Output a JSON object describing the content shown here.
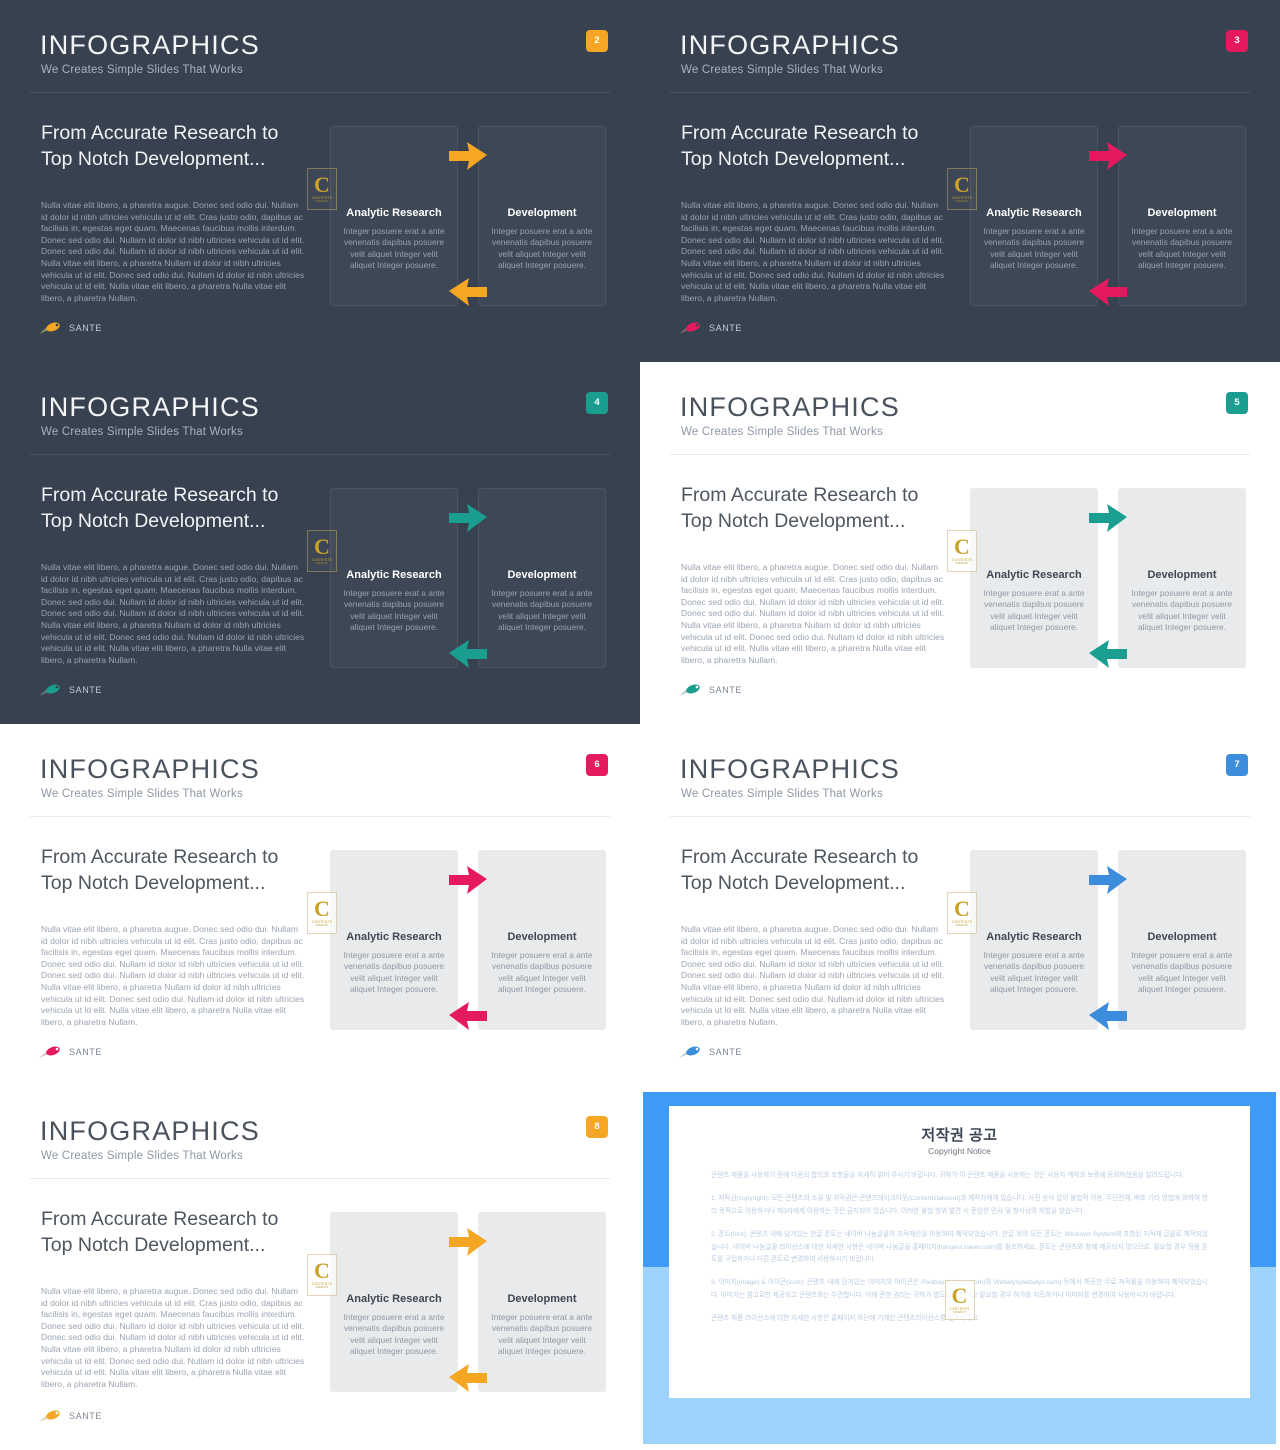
{
  "deck": {
    "header_title": "INFOGRAPHICS",
    "header_subtitle": "We Creates Simple Slides That Works",
    "lead": "From Accurate Research to Top Notch Development...",
    "paragraph": "Nulla vitae elit libero, a pharetra augue. Donec sed odio dui. Nullam id dolor id nibh ultricies vehicula ut id elit. Cras justo odio, dapibus ac facilisis in, egestas eget quam. Maecenas faucibus mollis interdum. Donec sed odio dui. Nullam id dolor id nibh ultricies vehicula ut id elit. Donec sed odio dui. Nullam id dolor id nibh ultricies vehicula ut id elit. Nulla vitae elit libero, a pharetra Nullam id dolor id nibh ultricies vehicula ut id elit. Donec sed odio dui. Nullam id dolor id nibh ultricies vehicula ut id elit. Nulla vitae elit libero, a pharetra Nulla vitae elit libero, a pharetra Nullam.",
    "card_a_title": "Analytic Research",
    "card_b_title": "Development",
    "card_body": "Integer posuere erat a ante venenatis dapibus posuere velit aliquet Integer velit aliquet Integer posuere.",
    "footer_brand": "SANTE",
    "watermark": {
      "letter": "C",
      "line1": "CONTENTS",
      "line2": "TAKEOUT"
    }
  },
  "slides": [
    {
      "number": "2",
      "theme": "dark",
      "accent": "#f5a623",
      "badge_color": "#f5a623",
      "arrow_color": "#f5a623"
    },
    {
      "number": "3",
      "theme": "dark",
      "accent": "#e51a5e",
      "badge_color": "#e51a5e",
      "arrow_color": "#e51a5e"
    },
    {
      "number": "4",
      "theme": "dark",
      "accent": "#1a9e8f",
      "badge_color": "#1a9e8f",
      "arrow_color": "#1a9e8f"
    },
    {
      "number": "5",
      "theme": "light",
      "accent": "#1a9e8f",
      "badge_color": "#1a9e8f",
      "arrow_color": "#1a9e8f"
    },
    {
      "number": "6",
      "theme": "light",
      "accent": "#e51a5e",
      "badge_color": "#e51a5e",
      "arrow_color": "#e51a5e"
    },
    {
      "number": "7",
      "theme": "light",
      "accent": "#3d8ddd",
      "badge_color": "#3d8ddd",
      "arrow_color": "#3d8ddd"
    },
    {
      "number": "8",
      "theme": "light",
      "accent": "#f5a623",
      "badge_color": "#f5a623",
      "arrow_color": "#f5a623"
    }
  ],
  "copyright": {
    "title": "저작권 공고",
    "subtitle": "Copyright Notice",
    "intro": "콘텐츠 제품을 사용하기 전에 다음의 합의과 조항들을 자세히 읽어 주시기 바랍니다. 귀하가 이 콘텐츠 제품을 사용하는 것은 사용자 계약과 보증에 동의하셨음을 알려드립니다.",
    "clause1": "1. 저작권(copyright): 모든 콘텐츠의 소유 및 저작권은 콘텐츠테이크아웃(Contentstakeout)과 제작자에게 있습니다. 사전 승낙 없이 불법적 이용, 무단전재, 배포 기타 방법에 의하여 영리 목적으로 이용하거나 제3자에게 이용하는 것은 금지되어 있습니다. 이러한 불법 행위 발견 시 준엄한 민사 및 형사상의 처벌을 받습니다.",
    "clause2": "2. 폰트(font): 콘텐츠 내에 담겨있는 한글 폰트는 네이버 나눔글꼴의 지적재산을 이용하여 제작되었습니다. 한글 외의 모든 폰트는 Windows System에 포함된 지적재 글꼴로 제작되었습니다. 네이버 나눔글꼴 라이선스에 대한 자세한 사항은 네이버 나눔글꼴 홈페이지(hangeul.naver.com)를 참조하세요. 폰트는 콘텐츠와 함께 제공되지 않으므로, 필요할 경우 정품 폰트를 구입하거나 다른 폰트로 변경하여 사용하시기 바랍니다.",
    "clause3": "3. 이미지(image) & 아이콘(icon): 콘텐츠 내에 담겨있는 이미지와 아이콘은 Pixabay(pixabay.com)와 Webalys(webalys.com) 등에서 제공한 무료 저작물을 이용하여 제작되었습니다. 이미지는 참고로만 제공되고 콘텐츠와는 무관합니다. 이에 관한 권리는 귀하가 별도로 확인하고 필요할 경우 허가를 취득하거나 이미지를 변경하여 사용하시기 바랍니다.",
    "outro": "콘텐츠 제품 라이선스에 대한 자세한 사항은 홈페이지 하단에 기재한 콘텐츠라이선스를 참조하세요.",
    "frame_top_color": "#3d9af5",
    "frame_bottom_color": "#9dd2fb"
  }
}
